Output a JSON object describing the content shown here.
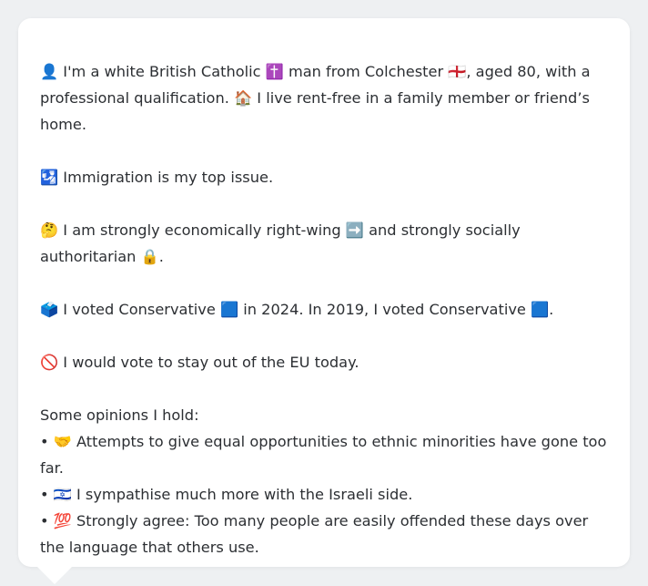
{
  "profile": {
    "intro": {
      "line1": "👤 I'm a white British Catholic ✝️ man from Colchester 🏴󠁧󠁢󠁥󠁮󠁧󠁿, aged 80, with a",
      "line2": "professional qualification. 🏠 I live rent-free in a family member or friend’s",
      "line3": "home."
    },
    "issue": "🛂 Immigration is my top issue.",
    "ideology": {
      "line1": "🤔 I am strongly economically right-wing ➡️ and strongly socially",
      "line2": "authoritarian 🔒."
    },
    "votes": "🗳️ I voted Conservative 🟦 in 2024. In 2019, I voted Conservative 🟦.",
    "eu": "🚫 I would vote to stay out of the EU today.",
    "opinions": {
      "heading": "Some opinions I hold:",
      "item1_line1": "• 🤝 Attempts to give equal opportunities to ethnic minorities have gone too",
      "item1_line2": "far.",
      "item2": "• 🇮🇱 I sympathise much more with the Israeli side.",
      "item3_line1": "• 💯 Strongly agree: Too many people are easily offended these days over",
      "item3_line2": "the language that others use."
    }
  },
  "colors": {
    "background": "#eef0f2",
    "bubble": "#ffffff",
    "text": "#2c2f33"
  }
}
